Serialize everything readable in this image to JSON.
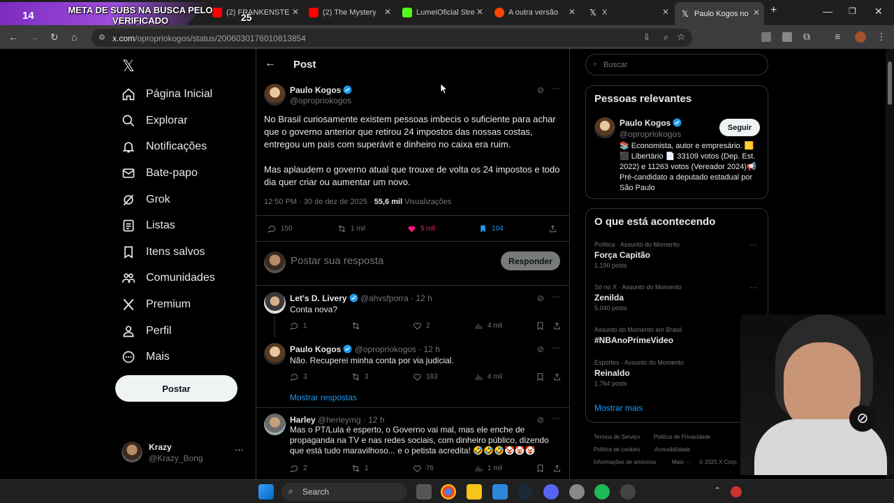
{
  "overlay": {
    "num_left": "14",
    "text": "META DE SUBS NA BUSCA PELO VERIFICADO",
    "num_right": "25"
  },
  "browser": {
    "tabs": [
      {
        "label": "(2) FRANKENSTE"
      },
      {
        "label": "(2) The Mystery"
      },
      {
        "label": "LumeiOficial Stre"
      },
      {
        "label": "A outra versão"
      },
      {
        "label": "X"
      },
      {
        "label": "Paulo Kogos no"
      }
    ],
    "url_host": "x.com",
    "url_path": "/opropriokogos/status/2006030176010813854"
  },
  "nav": {
    "items": [
      {
        "label": "Página Inicial",
        "icon": "home-icon"
      },
      {
        "label": "Explorar",
        "icon": "search-icon"
      },
      {
        "label": "Notificações",
        "icon": "bell-icon"
      },
      {
        "label": "Bate-papo",
        "icon": "mail-icon"
      },
      {
        "label": "Grok",
        "icon": "grok-icon"
      },
      {
        "label": "Listas",
        "icon": "list-icon"
      },
      {
        "label": "Itens salvos",
        "icon": "bookmark-icon"
      },
      {
        "label": "Comunidades",
        "icon": "people-icon"
      },
      {
        "label": "Premium",
        "icon": "x-logo-icon"
      },
      {
        "label": "Perfil",
        "icon": "person-icon"
      },
      {
        "label": "Mais",
        "icon": "more-circle-icon"
      }
    ],
    "post_button": "Postar",
    "account": {
      "name": "Krazy",
      "handle": "@Krazy_Bong"
    }
  },
  "post": {
    "header": "Post",
    "author": "Paulo Kogos",
    "handle": "@opropriokogos",
    "text_p1": "No Brasil curiosamente existem pessoas imbecis o suficiente para achar que o governo anterior que retirou 24 impostos das nossas costas, entregou um país com superávit e dinheiro no caixa era ruim.",
    "text_p2": "Mas aplaudem o governo atual que trouxe de volta os 24 impostos e todo dia quer criar ou aumentar um novo.",
    "time": "12:50 PM · 30 de dez de 2025 · ",
    "views": "55,6 mil",
    "views_label": " Visualizações",
    "replies": "150",
    "reposts": "1 mil",
    "likes": "5 mil",
    "bookmarks": "104",
    "reply_placeholder": "Postar sua resposta",
    "reply_button": "Responder",
    "like_color": "#f91880",
    "bookmark_color": "#1d9bf0"
  },
  "replies": [
    {
      "name": "Let's D. Livery",
      "handle": "@ahvsfporra · 12 h",
      "text": "Conta nova?",
      "replies": "1",
      "reposts": "",
      "likes": "2",
      "views": "4 mil"
    },
    {
      "name": "Paulo Kogos",
      "handle": "@opropriokogos · 12 h",
      "text": "Não. Recuperei minha conta por via judicial.",
      "replies": "3",
      "reposts": "3",
      "likes": "183",
      "views": "4 mil",
      "show_more": "Mostrar respostas"
    },
    {
      "name": "Harley",
      "handle": "@herleymg · 12 h",
      "text": "Mas o PT/Lula é esperto, o Governo vai mal, mas ele enche de propaganda na TV e nas redes sociais, com dinheiro público, dizendo que está tudo maravilhoso... e o petista acredita! 🤣🤣🤣🤡🤡🤡",
      "replies": "2",
      "reposts": "1",
      "likes": "76",
      "views": "1 mil"
    }
  ],
  "sidebar": {
    "search_placeholder": "Buscar",
    "relevant_title": "Pessoas relevantes",
    "relevant": {
      "name": "Paulo Kogos",
      "handle": "@opropriokogos",
      "follow": "Seguir",
      "bio": "📚 Economista, autor e empresário. 🟨⬛ Libertário 📄 33109 votos (Dep. Est. 2022) e 11263 votos (Vereador 2024)📢Pré-candidato a deputado estadual por São Paulo"
    },
    "trends_title": "O que está acontecendo",
    "trends": [
      {
        "meta": "Política · Assunto do Momento",
        "title": "Força Capitão",
        "count": "1.190 posts"
      },
      {
        "meta": "Só no X · Assunto do Momento",
        "title": "Zenilda",
        "count": "5.040 posts"
      },
      {
        "meta": "Assunto do Momento em Brasil",
        "title": "#NBAnoPrimeVideo",
        "count": ""
      },
      {
        "meta": "Esportes · Assunto do Momento",
        "title": "Reinaldo",
        "count": "1.764 posts"
      }
    ],
    "show_more": "Mostrar mais",
    "footer": [
      "Termos de Serviço",
      "Política de Privacidade",
      "Política de cookies",
      "Acessibilidade",
      "Informações de anúncios",
      "Mais ···",
      "© 2025 X Corp."
    ]
  },
  "taskbar": {
    "search": "Search"
  }
}
